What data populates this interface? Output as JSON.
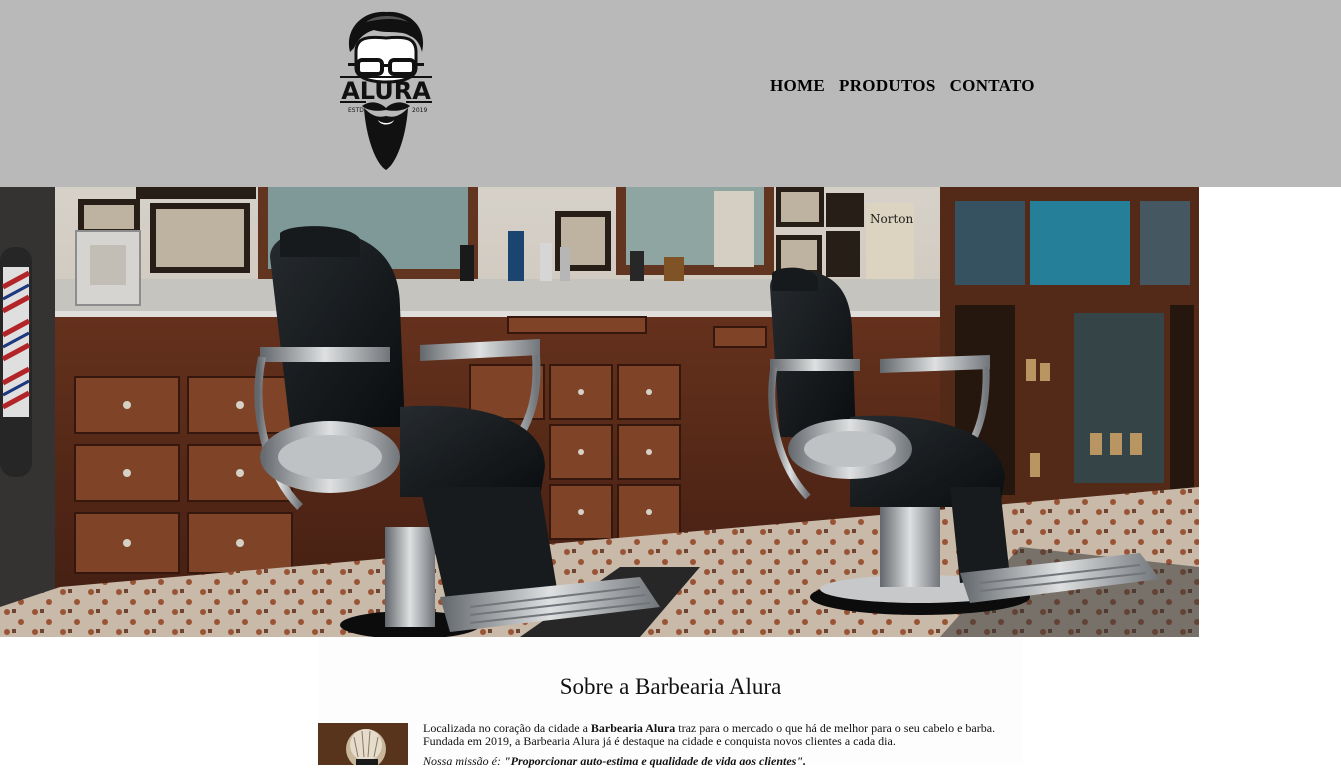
{
  "brand": {
    "logo_text": "ALURA",
    "logo_left": "ESTD",
    "logo_right": "2019"
  },
  "nav": {
    "items": [
      "HOME",
      "PRODUTOS",
      "CONTATO"
    ]
  },
  "about": {
    "title": "Sobre a Barbearia Alura",
    "p1_before": "Localizada no coração da cidade a ",
    "p1_bold": "Barbearia Alura",
    "p1_after": " traz para o mercado o que há de melhor para o seu cabelo e barba.",
    "p2": "Fundada em 2019, a Barbearia Alura já é destaque na cidade e conquista novos clientes a cada dia.",
    "mission_label": "Nossa missão é: ",
    "mission_text": "\"Proporcionar auto-estima e qualidade de vida aos clientes\"."
  },
  "colors": {
    "header_bg": "#b9b9b9",
    "page_bg": "#ffffff"
  }
}
